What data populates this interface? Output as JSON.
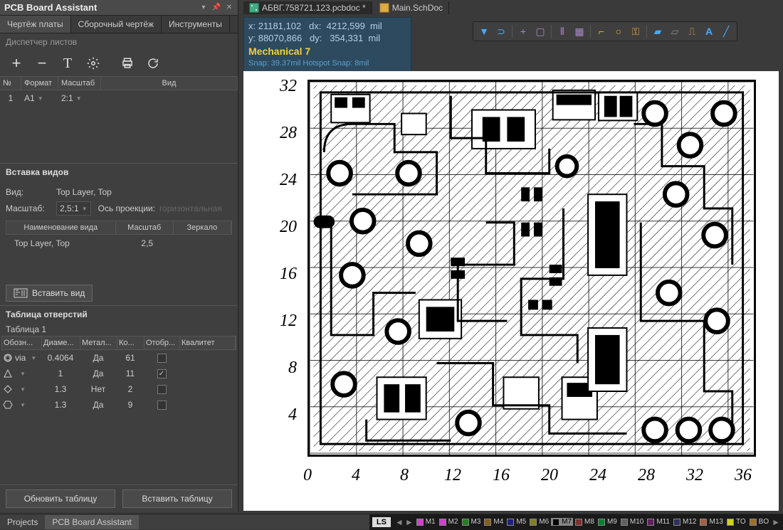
{
  "panel": {
    "title": "PCB Board Assistant",
    "tabs": [
      "Чертёж платы",
      "Сборочный чертёж",
      "Инструменты"
    ],
    "active_tab": 0
  },
  "sheet_mgr": {
    "title": "Диспетчер листов",
    "cols": [
      "№",
      "Формат",
      "Масштаб",
      "Вид"
    ],
    "row": {
      "num": "1",
      "format": "A1",
      "scale": "2:1"
    }
  },
  "insert_views": {
    "title": "Вставка видов",
    "view_label": "Вид:",
    "view_value": "Top Layer, Top",
    "scale_label": "Масштаб:",
    "scale_value": "2,5:1",
    "axis_label": "Ось проекции:",
    "axis_value": "горизонтальная",
    "table_cols": [
      "Наименование вида",
      "Масштаб",
      "Зеркало"
    ],
    "table_row": {
      "name": "Top Layer, Top",
      "scale": "2,5"
    },
    "insert_btn": "Вставить вид"
  },
  "holes": {
    "title": "Таблица отверстий",
    "subtitle": "Таблица 1",
    "cols": [
      "Обозн...",
      "Диаме...",
      "Метал...",
      "Ко...",
      "Отобр...",
      "Квалитет"
    ],
    "rows": [
      {
        "sym": "via",
        "dia": "0.4064",
        "metal": "Да",
        "count": "61",
        "show": false
      },
      {
        "sym": "tri",
        "dia": "1",
        "metal": "Да",
        "count": "11",
        "show": true
      },
      {
        "sym": "dia",
        "dia": "1.3",
        "metal": "Нет",
        "count": "2",
        "show": false
      },
      {
        "sym": "hex",
        "dia": "1.3",
        "metal": "Да",
        "count": "9",
        "show": false
      }
    ],
    "update_btn": "Обновить таблицу",
    "insert_btn": "Вставить таблицу"
  },
  "footer": {
    "tabs": [
      "Projects",
      "PCB Board Assistant"
    ],
    "active": 1,
    "ls": "LS",
    "layers": [
      {
        "name": "M1",
        "color": "#d040d0"
      },
      {
        "name": "M2",
        "color": "#d040d0"
      },
      {
        "name": "M3",
        "color": "#208020"
      },
      {
        "name": "M4",
        "color": "#806020"
      },
      {
        "name": "M5",
        "color": "#202080"
      },
      {
        "name": "M6",
        "color": "#808020"
      },
      {
        "name": "M7",
        "color": "#000"
      },
      {
        "name": "M8",
        "color": "#803030"
      },
      {
        "name": "M9",
        "color": "#008030"
      },
      {
        "name": "M10",
        "color": "#606060"
      },
      {
        "name": "M11",
        "color": "#602060"
      },
      {
        "name": "M12",
        "color": "#303060"
      },
      {
        "name": "M13",
        "color": "#a06040"
      },
      {
        "name": "TO",
        "color": "#d0d020"
      },
      {
        "name": "BO",
        "color": "#a07020"
      }
    ],
    "active_layer": 6
  },
  "doc_tabs": [
    {
      "name": "АБВГ.758721.123.pcbdoc *",
      "icon": "pcb",
      "active": true
    },
    {
      "name": "Main.SchDoc",
      "icon": "sch",
      "active": false
    }
  ],
  "coords": {
    "line1": "x: 21181,102   dx:  4212,599  mil",
    "line2": "y: 88070,866   dy:   354,331  mil",
    "layer": "Mechanical 7",
    "snap": "Snap: 39.37mil Hotspot Snap: 8mil"
  },
  "chart_data": {
    "type": "pcb-drawing",
    "y_ticks": [
      32,
      28,
      24,
      20,
      16,
      12,
      8,
      4
    ],
    "x_ticks": [
      0,
      4,
      8,
      12,
      16,
      20,
      24,
      28,
      32,
      36
    ],
    "x_range": [
      0,
      36
    ],
    "y_range": [
      0,
      32
    ]
  }
}
